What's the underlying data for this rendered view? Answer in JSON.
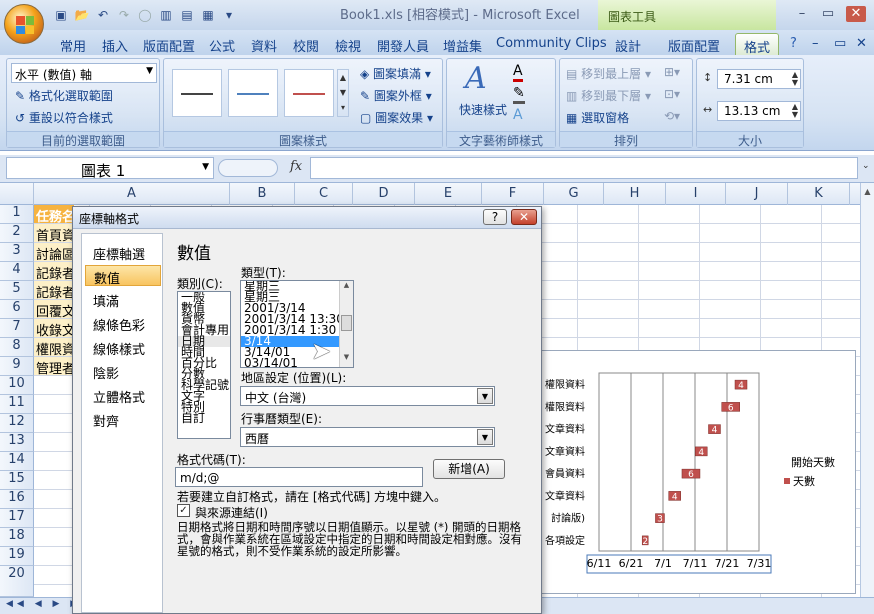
{
  "window": {
    "title": "Book1.xls  [相容模式] - Microsoft Excel",
    "context_tab": "圖表工具"
  },
  "tabs": [
    "常用",
    "插入",
    "版面配置",
    "公式",
    "資料",
    "校閱",
    "檢視",
    "開發人員",
    "增益集",
    "Community Clips",
    "設計",
    "版面配置",
    "格式"
  ],
  "ribbon": {
    "selection_dropdown": "水平 (數值) 軸",
    "format_selection": "格式化選取範圍",
    "reset_style": "重設以符合樣式",
    "group_current": "目前的選取範圍",
    "shape_fill": "圖案填滿",
    "shape_outline": "圖案外框",
    "shape_effects": "圖案效果",
    "group_shape_styles": "圖案樣式",
    "quick_styles": "快速樣式",
    "group_wordart": "文字藝術師樣式",
    "bring_front": "移到最上層",
    "send_back": "移到最下層",
    "selection_pane": "選取窗格",
    "group_arrange": "排列",
    "height": "7.31 cm",
    "width": "13.13 cm",
    "group_size": "大小",
    "swatch_colors": [
      "#444444",
      "#4f81bd",
      "#c0504d"
    ]
  },
  "formula_bar": {
    "name_box": "圖表 1",
    "fx": "fx"
  },
  "columns": [
    "A",
    "B",
    "C",
    "D",
    "E",
    "F",
    "G",
    "H",
    "I",
    "J",
    "K"
  ],
  "rows": [
    "1",
    "2",
    "3",
    "4",
    "5",
    "6",
    "7",
    "8",
    "9",
    "10",
    "11",
    "12",
    "13",
    "14",
    "15",
    "16",
    "17",
    "18",
    "19",
    "20"
  ],
  "cells": [
    "任務名",
    "首頁資",
    "討論區",
    "記錄者",
    "記錄者",
    "回覆文",
    "收錄文",
    "權限資",
    "管理者"
  ],
  "dialog": {
    "title": "座標軸格式",
    "help": "?",
    "close": "✕",
    "nav": [
      "座標軸選項",
      "數值",
      "填滿",
      "線條色彩",
      "線條樣式",
      "陰影",
      "立體格式",
      "對齊"
    ],
    "heading": "數值",
    "category_label": "類別(C):",
    "categories": [
      "一般",
      "數值",
      "貨幣",
      "會計專用",
      "日期",
      "時間",
      "百分比",
      "分數",
      "科學記號",
      "文字",
      "特別",
      "自訂"
    ],
    "type_label": "類型(T):",
    "types": [
      "星期三",
      "星期三",
      "2001/3/14",
      "2001/3/14 13:30",
      "2001/3/14 1:30 PM",
      "3/14",
      "3/14/01",
      "03/14/01"
    ],
    "locale_label": "地區設定 (位置)(L):",
    "locale_value": "中文 (台灣)",
    "calendar_label": "行事曆類型(E):",
    "calendar_value": "西曆",
    "format_code_label": "格式代碼(T):",
    "format_code_value": "m/d;@",
    "add_button": "新增(A)",
    "hint": "若要建立自訂格式，請在 [格式代碼] 方塊中鍵入。",
    "link_label": "與來源連結(I)",
    "link_mark": "✓",
    "description": "日期格式將日期和時間序號以日期值顯示。以星號 (*) 開頭的日期格式，會與作業系統在區域設定中指定的日期和時間設定相對應。沒有星號的格式，則不受作業系統的設定所影響。"
  },
  "chart_data": {
    "type": "bar",
    "categories": [
      "權限資料",
      "權限資料",
      "文章資料",
      "文章資料",
      "會員資料",
      "文章資料",
      "討論版)",
      "各項設定"
    ],
    "series": [
      {
        "name": "開始天數",
        "values": [
          null,
          null,
          null,
          null,
          null,
          null,
          null,
          null
        ]
      },
      {
        "name": "天數",
        "values": [
          4,
          6,
          4,
          4,
          6,
          4,
          3,
          2
        ]
      }
    ],
    "xticks": [
      "6/11",
      "6/21",
      "7/1",
      "7/11",
      "7/21",
      "7/31"
    ],
    "bar_color": "#c0504d"
  }
}
